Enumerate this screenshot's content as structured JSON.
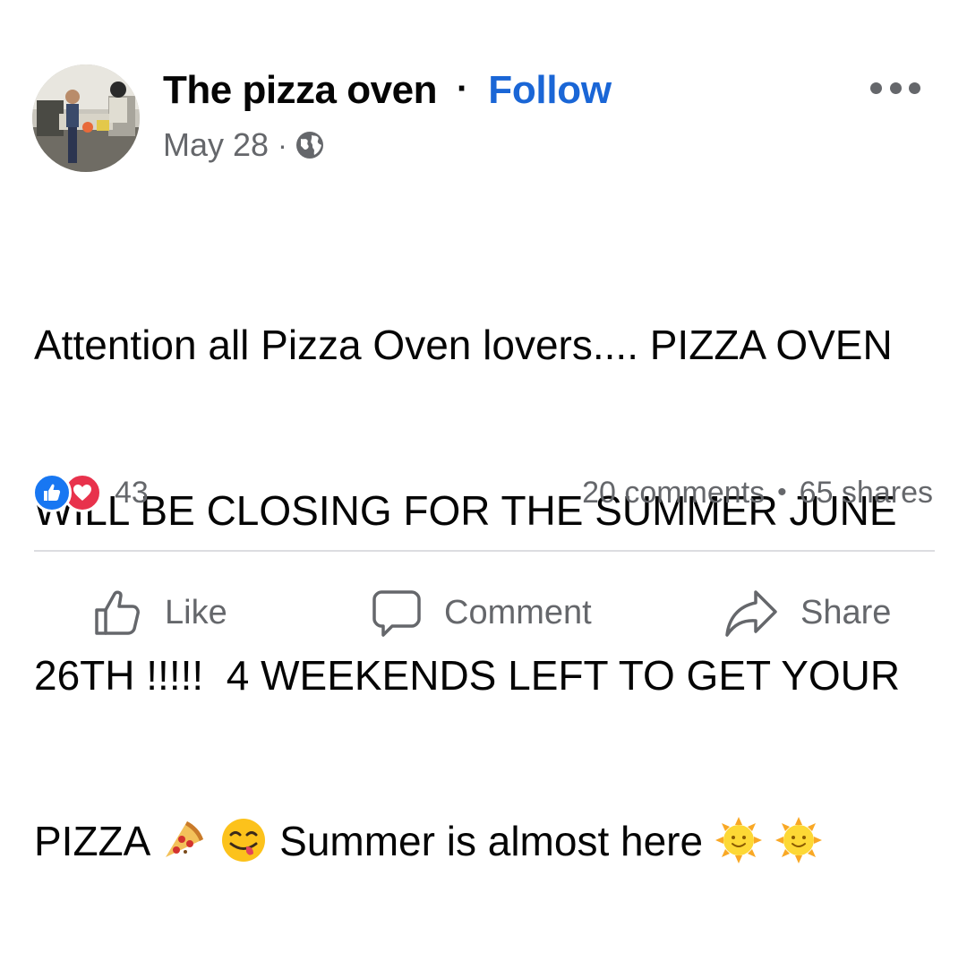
{
  "post": {
    "author": "The pizza oven",
    "separator": "·",
    "follow_label": "Follow",
    "date": "May 28",
    "meta_separator": "·",
    "privacy_icon": "globe-icon",
    "more_icon": "more-horizontal-icon",
    "text_lines": [
      "Attention all Pizza Oven lovers.... PIZZA OVEN",
      "WILL BE CLOSING FOR THE SUMMER JUNE",
      "26TH !!!!!  4 WEEKENDS LEFT TO GET YOUR",
      "PIZZA",
      "Summer is almost here"
    ],
    "emojis": [
      "pizza-emoji",
      "face-savoring-food-emoji",
      "sun-with-face-emoji",
      "sun-with-face-emoji"
    ]
  },
  "stats": {
    "reaction_icons": [
      "like-reaction-icon",
      "love-reaction-icon"
    ],
    "reaction_count": "43",
    "comments": "20 comments",
    "dot": "•",
    "shares": "65 shares"
  },
  "actions": {
    "like_label": "Like",
    "comment_label": "Comment",
    "share_label": "Share"
  },
  "colors": {
    "text": "#050505",
    "secondary": "#65676b",
    "follow": "#1a66d6",
    "like_blue": "#1877f2",
    "love_red": "#e8324c",
    "divider": "#dcdde1"
  }
}
